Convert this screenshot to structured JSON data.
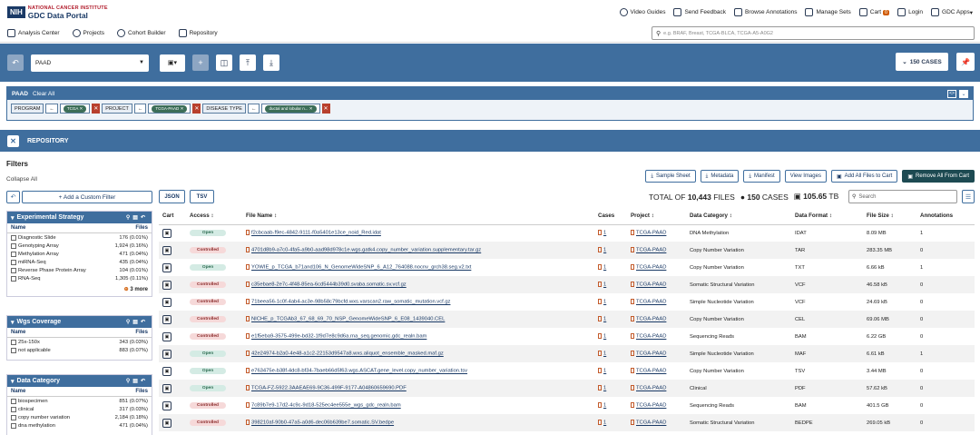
{
  "header": {
    "logo_mark": "NIH",
    "logo_line1": "NATIONAL CANCER INSTITUTE",
    "logo_line2": "GDC Data Portal",
    "nav": [
      "Video Guides",
      "Send Feedback",
      "Browse Annotations",
      "Manage Sets",
      "Cart",
      "Login",
      "GDC Apps"
    ],
    "cart_count": "0"
  },
  "subnav": {
    "items": [
      "Analysis Center",
      "Projects",
      "Cohort Builder",
      "Repository"
    ],
    "search_placeholder": "e.g. BRAF, Breast, TCGA-BLCA, TCGA-A5-A0G2"
  },
  "toolbar": {
    "cohort_name": "PAAD",
    "cases_label": "150 CASES"
  },
  "query": {
    "title": "PAAD",
    "clear_label": "Clear All",
    "filters": [
      {
        "field": "PROGRAM",
        "op": "←",
        "value": "TCGA"
      },
      {
        "field": "PROJECT",
        "op": "←",
        "value": "TCGA-PAAD"
      },
      {
        "field": "DISEASE TYPE",
        "op": "←",
        "value": "ductal and lobular n..."
      }
    ]
  },
  "repository": {
    "title": "REPOSITORY",
    "filters_title": "Filters",
    "collapse_all": "Collapse All",
    "add_filter": "+ Add a Custom Filter",
    "json_label": "JSON",
    "tsv_label": "TSV",
    "actions": [
      "Sample Sheet",
      "Metadata",
      "Manifest",
      "View Images",
      "Add All Files to Cart",
      "Remove All From Cart"
    ],
    "totals": {
      "prefix": "TOTAL OF",
      "files": "10,443",
      "files_label": "FILES",
      "cases": "150",
      "cases_label": "CASES",
      "size": "105.65",
      "size_unit": "TB"
    },
    "search_placeholder": "Search"
  },
  "facets": [
    {
      "title": "Experimental Strategy",
      "name_col": "Name",
      "files_col": "Files",
      "rows": [
        {
          "name": "Diagnostic Slide",
          "count": "176 (0.01%)"
        },
        {
          "name": "Genotyping Array",
          "count": "1,924 (0.16%)"
        },
        {
          "name": "Methylation Array",
          "count": "471 (0.04%)"
        },
        {
          "name": "miRNA-Seq",
          "count": "435 (0.04%)"
        },
        {
          "name": "Reverse Phase Protein Array",
          "count": "104 (0.01%)"
        },
        {
          "name": "RNA-Seq",
          "count": "1,305 (0.11%)"
        }
      ],
      "more": "3 more"
    },
    {
      "title": "Wgs Coverage",
      "name_col": "Name",
      "files_col": "Files",
      "rows": [
        {
          "name": "25x-150x",
          "count": "343 (0.03%)"
        },
        {
          "name": "not applicable",
          "count": "883 (0.07%)"
        }
      ],
      "more": ""
    },
    {
      "title": "Data Category",
      "name_col": "Name",
      "files_col": "Files",
      "rows": [
        {
          "name": "biospecimen",
          "count": "851 (0.07%)"
        },
        {
          "name": "clinical",
          "count": "317 (0.03%)"
        },
        {
          "name": "copy number variation",
          "count": "2,184 (0.18%)"
        },
        {
          "name": "dna methylation",
          "count": "471 (0.04%)"
        }
      ],
      "more": ""
    }
  ],
  "table": {
    "headers": [
      "Cart",
      "Access",
      "File Name",
      "Cases",
      "Project",
      "Data Category",
      "Data Format",
      "File Size",
      "Annotations"
    ],
    "rows": [
      {
        "access": "Open",
        "file": "f2cbcaab-f9ec-4842-9111-f0a5401e13ce_noid_Red.idat",
        "cases": "1",
        "project": "TCGA-PAAD",
        "category": "DNA Methylation",
        "format": "IDAT",
        "size": "8.09 MB",
        "ann": "1"
      },
      {
        "access": "Controlled",
        "file": "4701d8b9-a7c0-4fa5-a9b0-aad98d978c1e.wgs.gatk4.copy_number_variation.supplementary.tar.gz",
        "cases": "1",
        "project": "TCGA-PAAD",
        "category": "Copy Number Variation",
        "format": "TAR",
        "size": "283.35 MB",
        "ann": "0"
      },
      {
        "access": "Open",
        "file": "YOWIE_p_TCGA_b71and106_N_GenomeWideSNP_6_A12_764088.nocnv_grch38.seg.v2.txt",
        "cases": "1",
        "project": "TCGA-PAAD",
        "category": "Copy Number Variation",
        "format": "TXT",
        "size": "6.66 kB",
        "ann": "1"
      },
      {
        "access": "Controlled",
        "file": "c35ebae8-2e7c-4f48-85ea-6cd5444b39d0.svaba.somatic.sv.vcf.gz",
        "cases": "1",
        "project": "TCGA-PAAD",
        "category": "Somatic Structural Variation",
        "format": "VCF",
        "size": "46.58 kB",
        "ann": "0"
      },
      {
        "access": "Controlled",
        "file": "71beea56-1c0f-4ab4-ac3e-98b58c79bcfd.wxs.varscan2.raw_somatic_mutation.vcf.gz",
        "cases": "1",
        "project": "TCGA-PAAD",
        "category": "Simple Nucleotide Variation",
        "format": "VCF",
        "size": "24.69 kB",
        "ann": "0"
      },
      {
        "access": "Controlled",
        "file": "NICHE_p_TCGAb3_67_68_69_70_NSP_GenomeWideSNP_6_E08_1439040.CEL",
        "cases": "1",
        "project": "TCGA-PAAD",
        "category": "Copy Number Variation",
        "format": "CEL",
        "size": "69.06 MB",
        "ann": "0"
      },
      {
        "access": "Controlled",
        "file": "e1f5eba9-3575-499e-bd32-1f9d7e8c9d6a.rna_seq.genomic.gdc_realn.bam",
        "cases": "1",
        "project": "TCGA-PAAD",
        "category": "Sequencing Reads",
        "format": "BAM",
        "size": "6.22 GB",
        "ann": "0"
      },
      {
        "access": "Open",
        "file": "42e24974-b2a0-4e48-a1c2-22153d9547a8.wxs.aliquot_ensemble_masked.maf.gz",
        "cases": "1",
        "project": "TCGA-PAAD",
        "category": "Simple Nucleotide Variation",
        "format": "MAF",
        "size": "6.61 kB",
        "ann": "1"
      },
      {
        "access": "Open",
        "file": "e763475e-b38f-4dc8-bf34-7baeb66d5f63.wgs.ASCAT.gene_level.copy_number_variation.tsv",
        "cases": "1",
        "project": "TCGA-PAAD",
        "category": "Copy Number Variation",
        "format": "TSV",
        "size": "3.44 MB",
        "ann": "0"
      },
      {
        "access": "Open",
        "file": "TCGA-FZ-5922.3AAEAE69-9C36-499F-9177-A04860659690.PDF",
        "cases": "1",
        "project": "TCGA-PAAD",
        "category": "Clinical",
        "format": "PDF",
        "size": "57.62 kB",
        "ann": "0"
      },
      {
        "access": "Controlled",
        "file": "7c89b7e9-17d2-4c9c-9d18-525ec4ee555e_wgs_gdc_realn.bam",
        "cases": "1",
        "project": "TCGA-PAAD",
        "category": "Sequencing Reads",
        "format": "BAM",
        "size": "401.5 GB",
        "ann": "0"
      },
      {
        "access": "Controlled",
        "file": "398210af-90b0-47a5-a0d6-dec06b639be7.somatic.SV.bedpe",
        "cases": "1",
        "project": "TCGA-PAAD",
        "category": "Somatic Structural Variation",
        "format": "BEDPE",
        "size": "269.05 kB",
        "ann": "0"
      }
    ]
  },
  "colors": {
    "primary": "#3f6e9e",
    "dark_button": "#1d4a52",
    "open_badge": "#d4ebe4",
    "controlled_badge": "#f6d9d9",
    "remove_x": "#b8402d"
  }
}
